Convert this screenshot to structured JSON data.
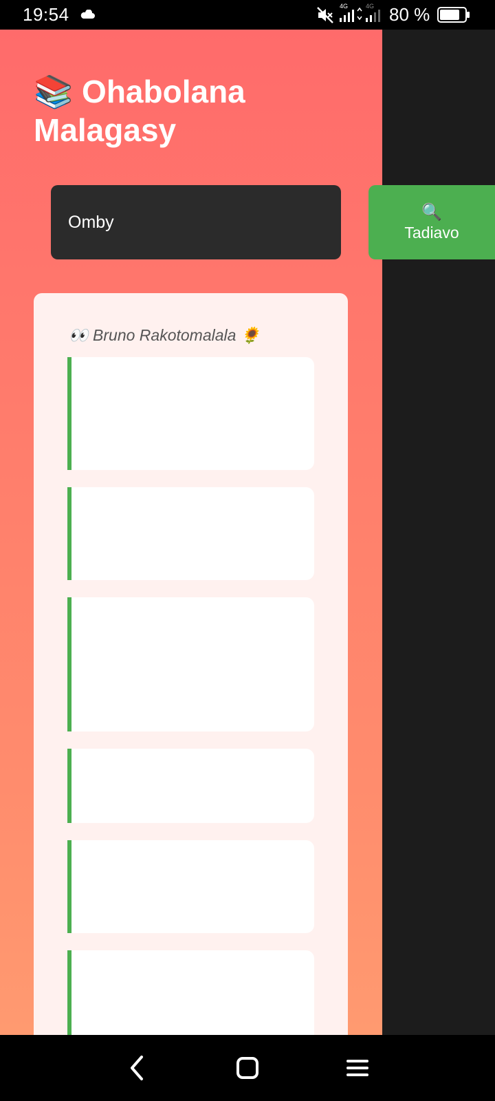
{
  "status_bar": {
    "time": "19:54",
    "network_label_1": "4G",
    "network_label_2": "4G",
    "battery_percent": "80 %",
    "battery_level": 0.8,
    "icons": [
      "cloud-icon",
      "mute-icon",
      "signal-icon",
      "signal-icon",
      "battery-icon"
    ]
  },
  "app": {
    "title": "📚 Ohabolana Malagasy",
    "search": {
      "value": "Omby",
      "placeholder": ""
    },
    "search_button": {
      "icon": "🔍",
      "label": "Tadiavo"
    },
    "results": {
      "author_line": "👀 Bruno Rakotomalala 🌻",
      "cards": [
        {
          "text": ""
        },
        {
          "text": ""
        },
        {
          "text": ""
        },
        {
          "text": ""
        },
        {
          "text": ""
        },
        {
          "text": ""
        }
      ]
    }
  },
  "nav_bar": {
    "icons": [
      "back-icon",
      "home-icon",
      "menu-icon"
    ]
  },
  "colors": {
    "header_gradient_top": "#ff6b6b",
    "header_gradient_bottom": "#ff9a70",
    "accent_green": "#4caf50",
    "input_background": "#2b2b2b",
    "panel_background": "#fff1ef",
    "page_background": "#1c1c1c"
  }
}
